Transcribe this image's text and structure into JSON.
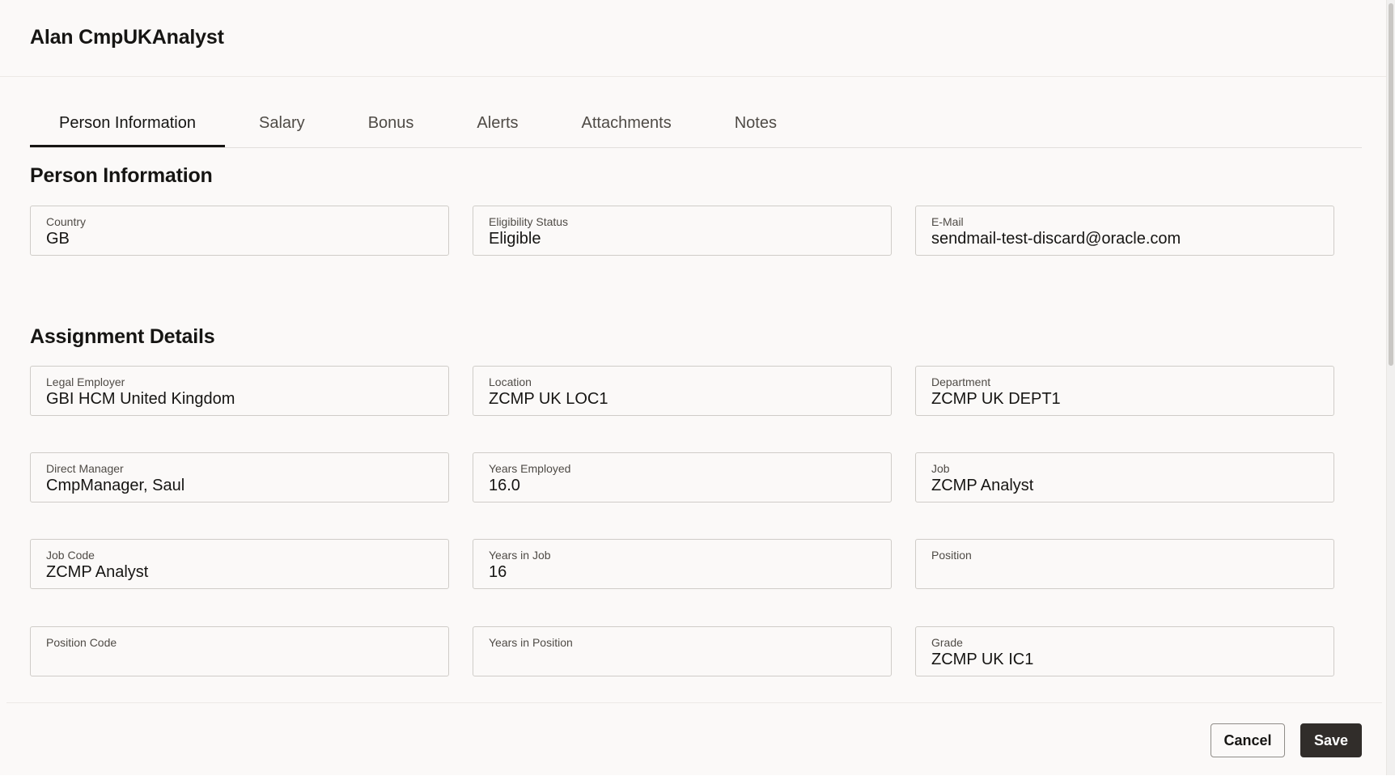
{
  "dialog": {
    "title": "Alan CmpUKAnalyst"
  },
  "tabs": [
    {
      "label": "Person Information",
      "active": true
    },
    {
      "label": "Salary",
      "active": false
    },
    {
      "label": "Bonus",
      "active": false
    },
    {
      "label": "Alerts",
      "active": false
    },
    {
      "label": "Attachments",
      "active": false
    },
    {
      "label": "Notes",
      "active": false
    }
  ],
  "person_information": {
    "title": "Person Information",
    "fields": [
      {
        "label": "Country",
        "value": "GB"
      },
      {
        "label": "Eligibility Status",
        "value": "Eligible"
      },
      {
        "label": "E-Mail",
        "value": "sendmail-test-discard@oracle.com"
      }
    ]
  },
  "assignment_details": {
    "title": "Assignment Details",
    "fields": [
      {
        "label": "Legal Employer",
        "value": "GBI HCM United Kingdom"
      },
      {
        "label": "Location",
        "value": "ZCMP UK LOC1"
      },
      {
        "label": "Department",
        "value": "ZCMP UK DEPT1"
      },
      {
        "label": "Direct Manager",
        "value": "CmpManager, Saul"
      },
      {
        "label": "Years Employed",
        "value": "16.0"
      },
      {
        "label": "Job",
        "value": "ZCMP Analyst"
      },
      {
        "label": "Job Code",
        "value": "ZCMP Analyst"
      },
      {
        "label": "Years in Job",
        "value": "16"
      },
      {
        "label": "Position",
        "value": ""
      },
      {
        "label": "Position Code",
        "value": ""
      },
      {
        "label": "Years in Position",
        "value": ""
      },
      {
        "label": "Grade",
        "value": "ZCMP UK IC1"
      }
    ]
  },
  "footer": {
    "cancel_label": "Cancel",
    "save_label": "Save"
  },
  "colors": {
    "background": "#fbf9f8",
    "primary_button": "#312d2a",
    "border": "#cfccc8",
    "text": "#161513"
  }
}
